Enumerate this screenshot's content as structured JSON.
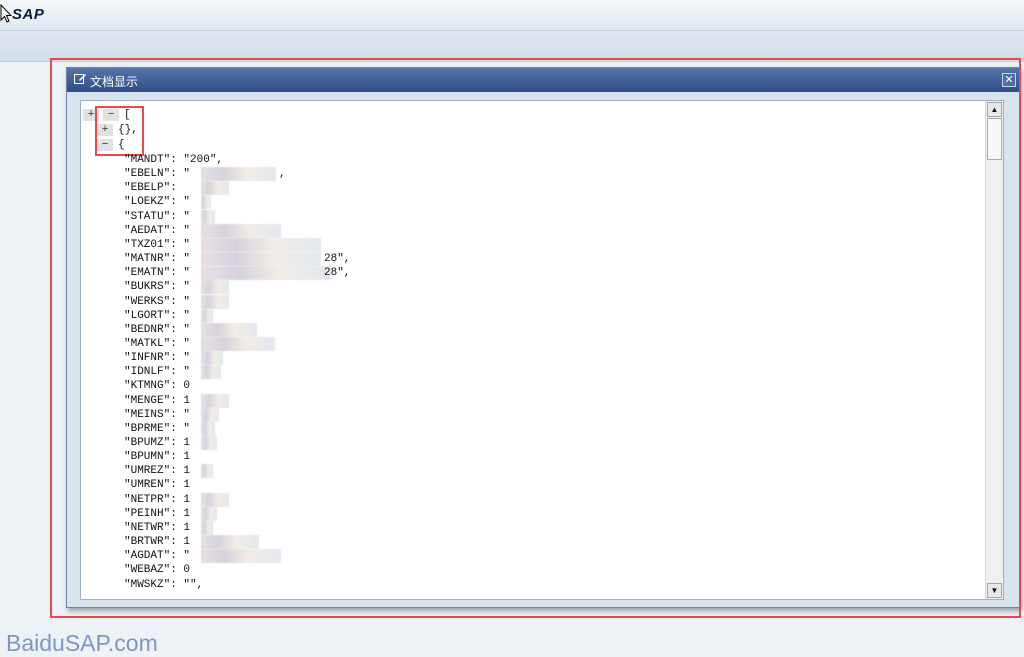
{
  "header": {
    "logo": "SAP"
  },
  "dialog": {
    "title": "文档显示",
    "close": "✕"
  },
  "viewer": {
    "toggle_expand": "+",
    "toggle_collapse": "−",
    "root_open": "[",
    "collapsed_obj": "{},",
    "open_obj": "{",
    "lines": [
      "\"MANDT\": \"200\",",
      "\"EBELN\": \"",
      "\"EBELP\": ",
      "\"LOEKZ\": \"",
      "\"STATU\": \"",
      "\"AEDAT\": \"",
      "\"TXZ01\": \"",
      "\"MATNR\": \"",
      "\"EMATN\": \"",
      "\"BUKRS\": \"",
      "\"WERKS\": \"",
      "\"LGORT\": \"",
      "\"BEDNR\": \"",
      "\"MATKL\": \"",
      "\"INFNR\": \"",
      "\"IDNLF\": \"",
      "\"KTMNG\": 0",
      "\"MENGE\": 1",
      "\"MEINS\": \"",
      "\"BPRME\": \"",
      "\"BPUMZ\": 1",
      "\"BPUMN\": 1",
      "\"UMREZ\": 1",
      "\"UMREN\": 1",
      "\"NETPR\": 1",
      "\"PEINH\": 1",
      "\"NETWR\": 1",
      "\"BRTWR\": 1",
      "\"AGDAT\": \"",
      "\"WEBAZ\": 0",
      "\"MWSKZ\": \"\","
    ],
    "trailing": {
      "ebeln": ",",
      "matnr": "28\",",
      "ematn": "28\","
    }
  },
  "watermark": "BaiduSAP.com"
}
